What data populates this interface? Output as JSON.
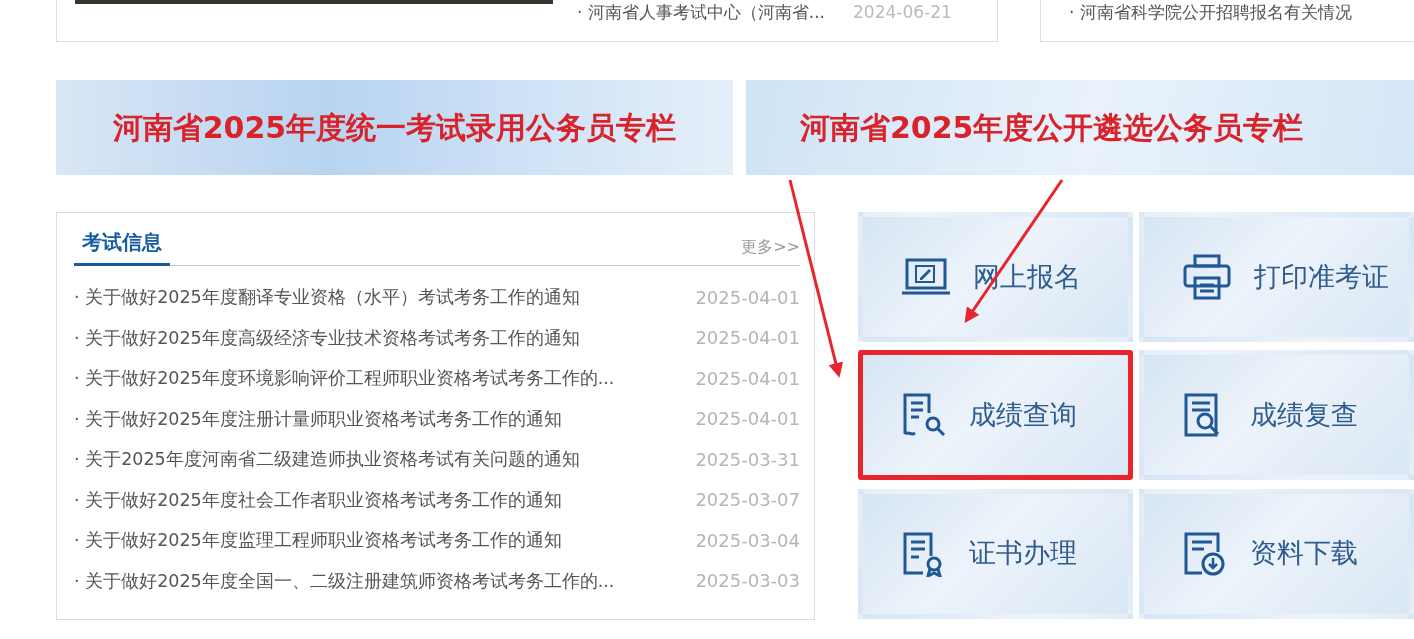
{
  "top_cards": [
    {
      "items": [
        {
          "title": "· 河南省人事考试中心（河南省...",
          "date": "2024-06-21"
        }
      ]
    },
    {
      "items": [
        {
          "title": "· 河南省科学院公开招聘报名有关情况"
        }
      ]
    }
  ],
  "banners": [
    {
      "text": "河南省2025年度统一考试录用公务员专栏"
    },
    {
      "text": "河南省2025年度公开遴选公务员专栏"
    }
  ],
  "news": {
    "title": "考试信息",
    "more": "更多>>",
    "items": [
      {
        "title": "· 关于做好2025年度翻译专业资格（水平）考试考务工作的通知",
        "date": "2025-04-01"
      },
      {
        "title": "· 关于做好2025年度高级经济专业技术资格考试考务工作的通知",
        "date": "2025-04-01"
      },
      {
        "title": "· 关于做好2025年度环境影响评价工程师职业资格考试考务工作的...",
        "date": "2025-04-01"
      },
      {
        "title": "· 关于做好2025年度注册计量师职业资格考试考务工作的通知",
        "date": "2025-04-01"
      },
      {
        "title": "· 关于2025年度河南省二级建造师执业资格考试有关问题的通知",
        "date": "2025-03-31"
      },
      {
        "title": "·  关于做好2025年度社会工作者职业资格考试考务工作的通知",
        "date": "2025-03-07"
      },
      {
        "title": "· 关于做好2025年度监理工程师职业资格考试考务工作的通知",
        "date": "2025-03-04"
      },
      {
        "title": "· 关于做好2025年度全国一、二级注册建筑师资格考试考务工作的...",
        "date": "2025-03-03"
      }
    ]
  },
  "tiles": [
    {
      "label": "网上报名",
      "kind": "register",
      "highlighted": false
    },
    {
      "label": "打印准考证",
      "kind": "print",
      "highlighted": false
    },
    {
      "label": "成绩查询",
      "kind": "score",
      "highlighted": true
    },
    {
      "label": "成绩复查",
      "kind": "review",
      "highlighted": false
    },
    {
      "label": "证书办理",
      "kind": "certificate",
      "highlighted": false
    },
    {
      "label": "资料下载",
      "kind": "download",
      "highlighted": false
    }
  ]
}
